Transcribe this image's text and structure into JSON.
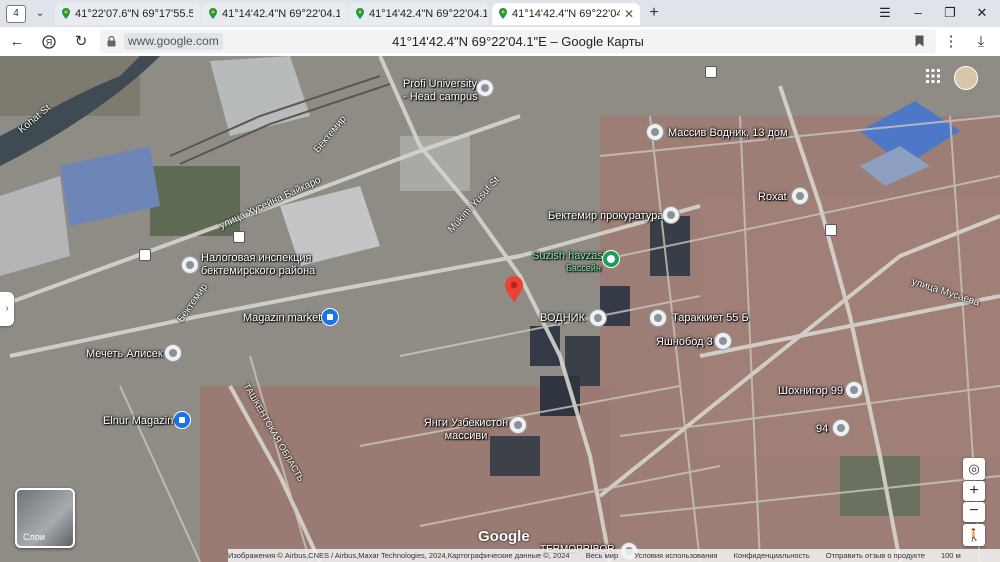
{
  "browser": {
    "tab_count": "4",
    "tabs": [
      {
        "title": "41°22'07.6\"N 69°17'55.5\"E",
        "active": false
      },
      {
        "title": "41°14'42.4\"N 69°22'04.1\"E",
        "active": false
      },
      {
        "title": "41°14'42.4\"N 69°22'04.1\"E",
        "active": false
      },
      {
        "title": "41°14'42.4\"N 69°22'04.1\"E",
        "active": true
      }
    ],
    "domain": "www.google.com",
    "page_title": "41°14'42.4\"N 69°22'04.1\"E – Google Карты"
  },
  "map": {
    "places": [
      "Profi University - Head campus",
      "Массив Водник, 13 дом",
      "Roxat",
      "Бектемир прокуратура",
      "Suzish havzasi",
      "Бассейн",
      "Налоговая инспекция бектемирского района",
      "Magazin market",
      "Мечеть Алисек",
      "ВОДНИК",
      "Тараккиет 55 Б",
      "Яшнобод 3",
      "Шохнигор 99",
      "94",
      "Янги Узбекистон массиви",
      "Elnur Magazin",
      "TERMOPRIBOR"
    ],
    "roads": [
      "Kohat St",
      "Бектемир",
      "улица Хусейна Байкаро",
      "Mukimi Yusuf St",
      "улица Мусаева",
      "Бектемир",
      "ТАШКЕНТСКАЯ ОБЛАСТЬ"
    ],
    "logo": "Google",
    "layers_label": "Слои",
    "footer": [
      "Изображения © Airbus,CNES / Airbus,Maxar Technologies, 2024,Картографические данные ©, 2024",
      "Весь мир",
      "Условия использования",
      "Конфиденциальность",
      "Отправить отзыв о продукте",
      "100 м"
    ]
  }
}
